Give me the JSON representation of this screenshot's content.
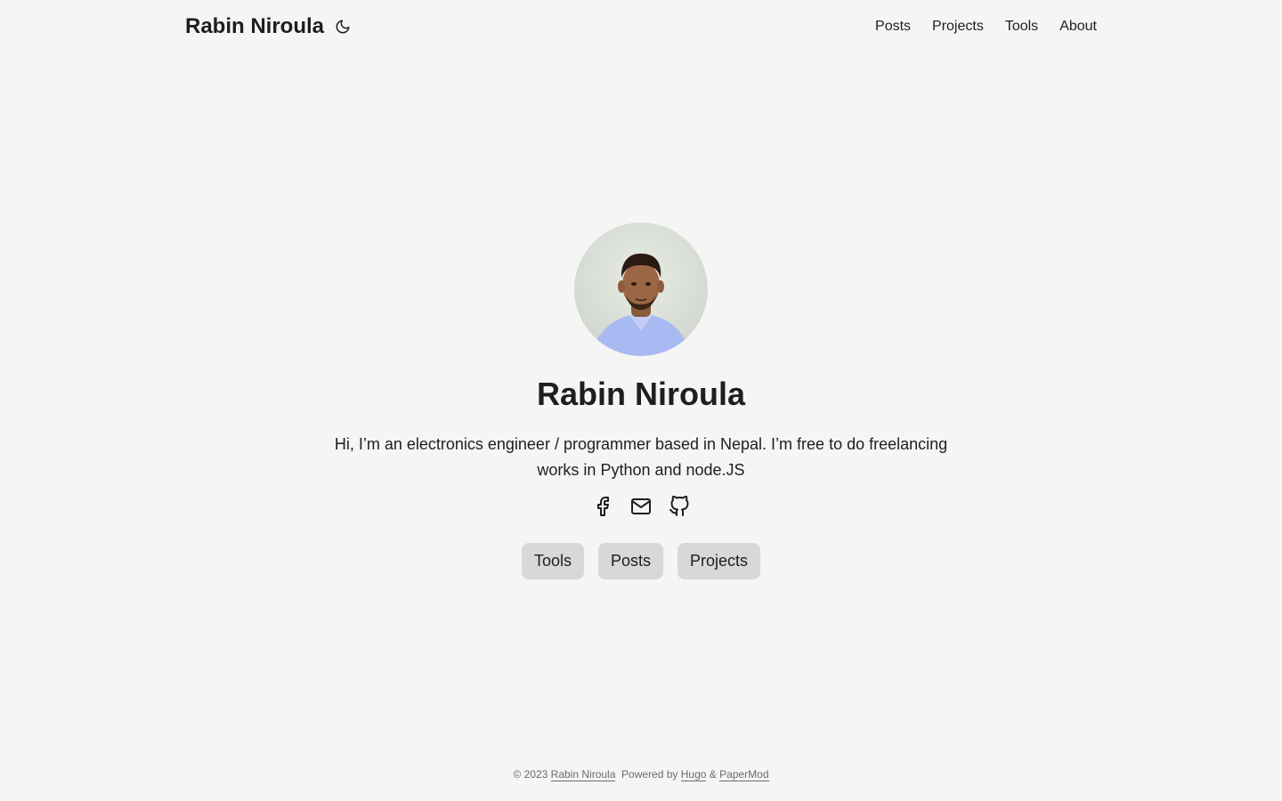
{
  "header": {
    "logo": "Rabin Niroula",
    "theme_toggle_icon": "moon-icon",
    "menu": [
      {
        "label": "Posts"
      },
      {
        "label": "Projects"
      },
      {
        "label": "Tools"
      },
      {
        "label": "About"
      }
    ]
  },
  "profile": {
    "avatar_icon": "profile-photo",
    "name": "Rabin Niroula",
    "bio": "Hi, I’m an electronics engineer / programmer based in Nepal. I’m free to do freelancing works in Python and node.JS",
    "social": [
      {
        "icon": "facebook-icon"
      },
      {
        "icon": "email-icon"
      },
      {
        "icon": "github-icon"
      }
    ],
    "buttons": [
      {
        "label": "Tools"
      },
      {
        "label": "Posts"
      },
      {
        "label": "Projects"
      }
    ]
  },
  "footer": {
    "copyright": "© 2023",
    "author": "Rabin Niroula",
    "powered_by": "Powered by",
    "hugo": "Hugo",
    "amp": "&",
    "theme": "PaperMod"
  },
  "colors": {
    "background": "#f5f5f5",
    "text": "#1e1e1e",
    "button_bg": "#d8d8d8",
    "footer_text": "#6b6b6b"
  }
}
